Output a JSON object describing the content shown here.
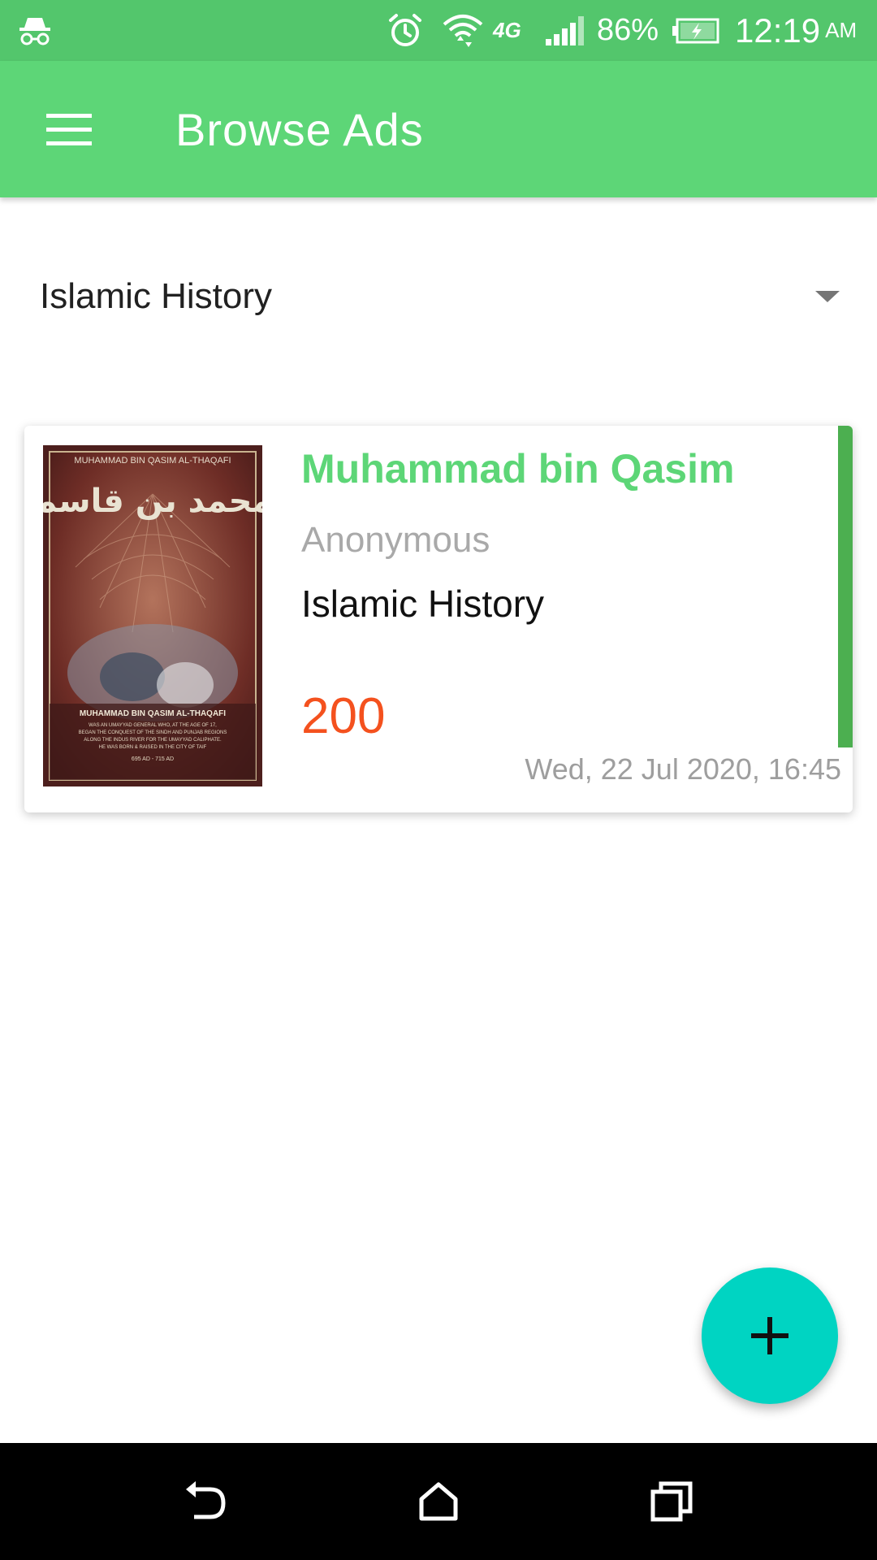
{
  "status_bar": {
    "battery_percent": "86%",
    "time": "12:19",
    "am_pm": "AM",
    "icons": [
      "incognito-icon",
      "alarm-icon",
      "wifi-icon",
      "4g-icon",
      "signal-icon",
      "battery-charging-icon"
    ]
  },
  "app_bar": {
    "title": "Browse Ads",
    "menu_icon": "hamburger-menu-icon"
  },
  "category_filter": {
    "selected": "Islamic History"
  },
  "ads": [
    {
      "title": "Muhammad bin Qasim",
      "author": "Anonymous",
      "category": "Islamic History",
      "price": "200",
      "date": "Wed, 22 Jul 2020, 16:45",
      "cover": {
        "header_text": "MUHAMMAD BIN QASIM AL-THAQAFI",
        "arabic_title": "محمد بن قاسم",
        "caption_title": "MUHAMMAD BIN QASIM AL-THAQAFI",
        "caption_lines": [
          "WAS AN UMAYYAD GENERAL WHO, AT THE AGE OF 17,",
          "BEGAN THE CONQUEST OF THE SINDH AND PUNJAB REGIONS",
          "ALONG THE INDUS RIVER FOR THE UMAYYAD CALIPHATE.",
          "HE WAS BORN & RAISED IN THE CITY OF TAIF"
        ],
        "years": "695 AD - 715 AD"
      }
    }
  ],
  "fab": {
    "icon": "plus-icon"
  },
  "colors": {
    "status_bar": "#53c66c",
    "app_bar": "#5dd677",
    "title_green": "#5dd677",
    "accent_bar": "#4caf50",
    "price": "#f4511e",
    "fab": "#00d4c2"
  }
}
